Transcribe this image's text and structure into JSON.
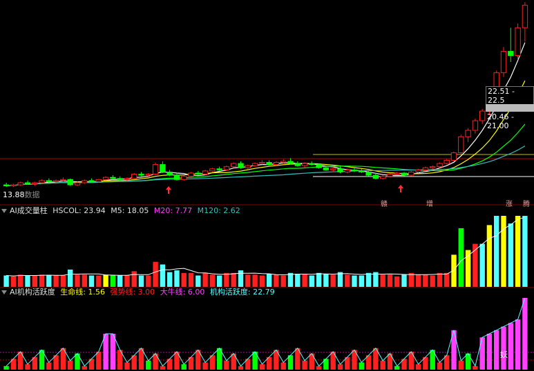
{
  "colors": {
    "up": "#ff2020",
    "down": "#00e0e0",
    "downfill": "#00ff00",
    "ma5": "#ffffff",
    "ma10": "#ffff00",
    "ma20": "#ff00ff",
    "ma60": "#00ff00",
    "ma120": "#30c0c0",
    "yellow": "#ffff00",
    "cyan": "#54ffff",
    "magenta": "#ff40ff",
    "green": "#00ff00"
  },
  "price_panel": {
    "low_label": "13.88",
    "low_suffix": "数据",
    "price_box_1": "22.51 - 22.5",
    "price_box_2": "20.46 - 21.00",
    "signals": [
      "赣",
      "增",
      "涨",
      "腾"
    ],
    "arrows": [
      "up-arrow",
      "up-arrow"
    ]
  },
  "volume_panel": {
    "title": "AI成交量柱",
    "hscol": "HSCOL: 23.94",
    "m5": "M5: 18.05",
    "m20": "M20: 7.77",
    "m120": "M120: 2.62"
  },
  "activity_panel": {
    "title": "AI机构活跃度",
    "life": "生命线: 1.56",
    "strong": "强势线: 3.00",
    "bull": "大牛线: 6.00",
    "active": "机构活跃度: 22.79",
    "tag": "妖"
  },
  "chart_data": {
    "type": "candlestick",
    "candles": [
      [
        14.1,
        14.3,
        13.9,
        14.0
      ],
      [
        14.0,
        14.2,
        13.9,
        14.1
      ],
      [
        14.1,
        14.4,
        14.0,
        14.3
      ],
      [
        14.3,
        14.5,
        14.1,
        14.2
      ],
      [
        14.2,
        14.4,
        14.0,
        14.3
      ],
      [
        14.3,
        14.6,
        14.2,
        14.5
      ],
      [
        14.5,
        14.7,
        14.3,
        14.4
      ],
      [
        14.4,
        14.6,
        14.2,
        14.5
      ],
      [
        14.5,
        14.8,
        14.4,
        14.6
      ],
      [
        14.6,
        14.7,
        14.0,
        14.1
      ],
      [
        14.1,
        14.4,
        14.0,
        14.3
      ],
      [
        14.3,
        14.6,
        14.2,
        14.5
      ],
      [
        14.5,
        14.7,
        14.3,
        14.4
      ],
      [
        14.4,
        14.6,
        14.3,
        14.6
      ],
      [
        14.6,
        14.9,
        14.5,
        14.8
      ],
      [
        14.8,
        15.0,
        14.6,
        14.7
      ],
      [
        14.7,
        14.9,
        14.5,
        14.6
      ],
      [
        14.6,
        14.8,
        14.4,
        14.7
      ],
      [
        14.7,
        15.2,
        14.6,
        15.1
      ],
      [
        15.1,
        15.3,
        14.9,
        15.0
      ],
      [
        15.0,
        15.2,
        14.8,
        15.1
      ],
      [
        15.1,
        16.2,
        15.0,
        16.0
      ],
      [
        16.0,
        16.3,
        15.2,
        15.3
      ],
      [
        15.3,
        15.5,
        14.9,
        15.0
      ],
      [
        15.0,
        15.2,
        14.5,
        14.6
      ],
      [
        14.6,
        15.0,
        14.5,
        14.9
      ],
      [
        14.9,
        15.3,
        14.8,
        15.2
      ],
      [
        15.2,
        15.4,
        15.0,
        15.1
      ],
      [
        15.1,
        15.5,
        15.0,
        15.4
      ],
      [
        15.4,
        15.7,
        15.3,
        15.6
      ],
      [
        15.6,
        15.8,
        15.4,
        15.5
      ],
      [
        15.5,
        15.9,
        15.4,
        15.8
      ],
      [
        15.8,
        16.2,
        15.7,
        16.1
      ],
      [
        16.1,
        16.3,
        15.6,
        15.7
      ],
      [
        15.7,
        16.0,
        15.6,
        15.9
      ],
      [
        15.9,
        16.2,
        15.8,
        16.1
      ],
      [
        16.1,
        16.4,
        16.0,
        16.2
      ],
      [
        16.2,
        16.4,
        15.9,
        16.0
      ],
      [
        16.0,
        16.3,
        15.9,
        16.2
      ],
      [
        16.2,
        16.5,
        16.1,
        16.3
      ],
      [
        16.3,
        16.6,
        16.0,
        16.1
      ],
      [
        16.1,
        16.3,
        15.8,
        15.9
      ],
      [
        15.9,
        16.2,
        15.7,
        16.1
      ],
      [
        16.1,
        16.3,
        15.9,
        16.0
      ],
      [
        16.0,
        16.1,
        15.6,
        15.7
      ],
      [
        15.7,
        15.9,
        15.4,
        15.5
      ],
      [
        15.5,
        15.8,
        15.3,
        15.6
      ],
      [
        15.6,
        15.8,
        15.2,
        15.3
      ],
      [
        15.3,
        15.6,
        15.2,
        15.5
      ],
      [
        15.5,
        15.7,
        15.3,
        15.4
      ],
      [
        15.4,
        15.6,
        15.2,
        15.3
      ],
      [
        15.3,
        15.4,
        14.9,
        15.0
      ],
      [
        15.0,
        15.2,
        14.6,
        14.7
      ],
      [
        14.7,
        15.0,
        14.6,
        14.9
      ],
      [
        14.9,
        15.2,
        14.8,
        15.1
      ],
      [
        15.1,
        15.3,
        15.0,
        15.2
      ],
      [
        15.2,
        15.3,
        14.9,
        15.0
      ],
      [
        15.0,
        15.4,
        14.9,
        15.3
      ],
      [
        15.3,
        15.6,
        15.2,
        15.5
      ],
      [
        15.5,
        15.8,
        15.4,
        15.7
      ],
      [
        15.7,
        15.9,
        15.5,
        15.8
      ],
      [
        15.8,
        16.2,
        15.7,
        16.1
      ],
      [
        16.1,
        16.5,
        16.0,
        16.4
      ],
      [
        16.4,
        17.2,
        16.3,
        17.1
      ],
      [
        17.1,
        18.8,
        17.0,
        18.6
      ],
      [
        18.6,
        19.4,
        18.1,
        19.2
      ],
      [
        19.2,
        20.3,
        18.9,
        20.1
      ],
      [
        20.1,
        21.2,
        19.8,
        21.0
      ],
      [
        21.0,
        22.6,
        20.6,
        22.5
      ],
      [
        22.5,
        24.8,
        22.2,
        24.6
      ],
      [
        24.6,
        27.0,
        24.2,
        26.6
      ],
      [
        26.6,
        28.8,
        25.6,
        26.2
      ],
      [
        26.2,
        29.2,
        25.8,
        28.8
      ],
      [
        28.8,
        31.2,
        27.5,
        30.9
      ]
    ]
  }
}
